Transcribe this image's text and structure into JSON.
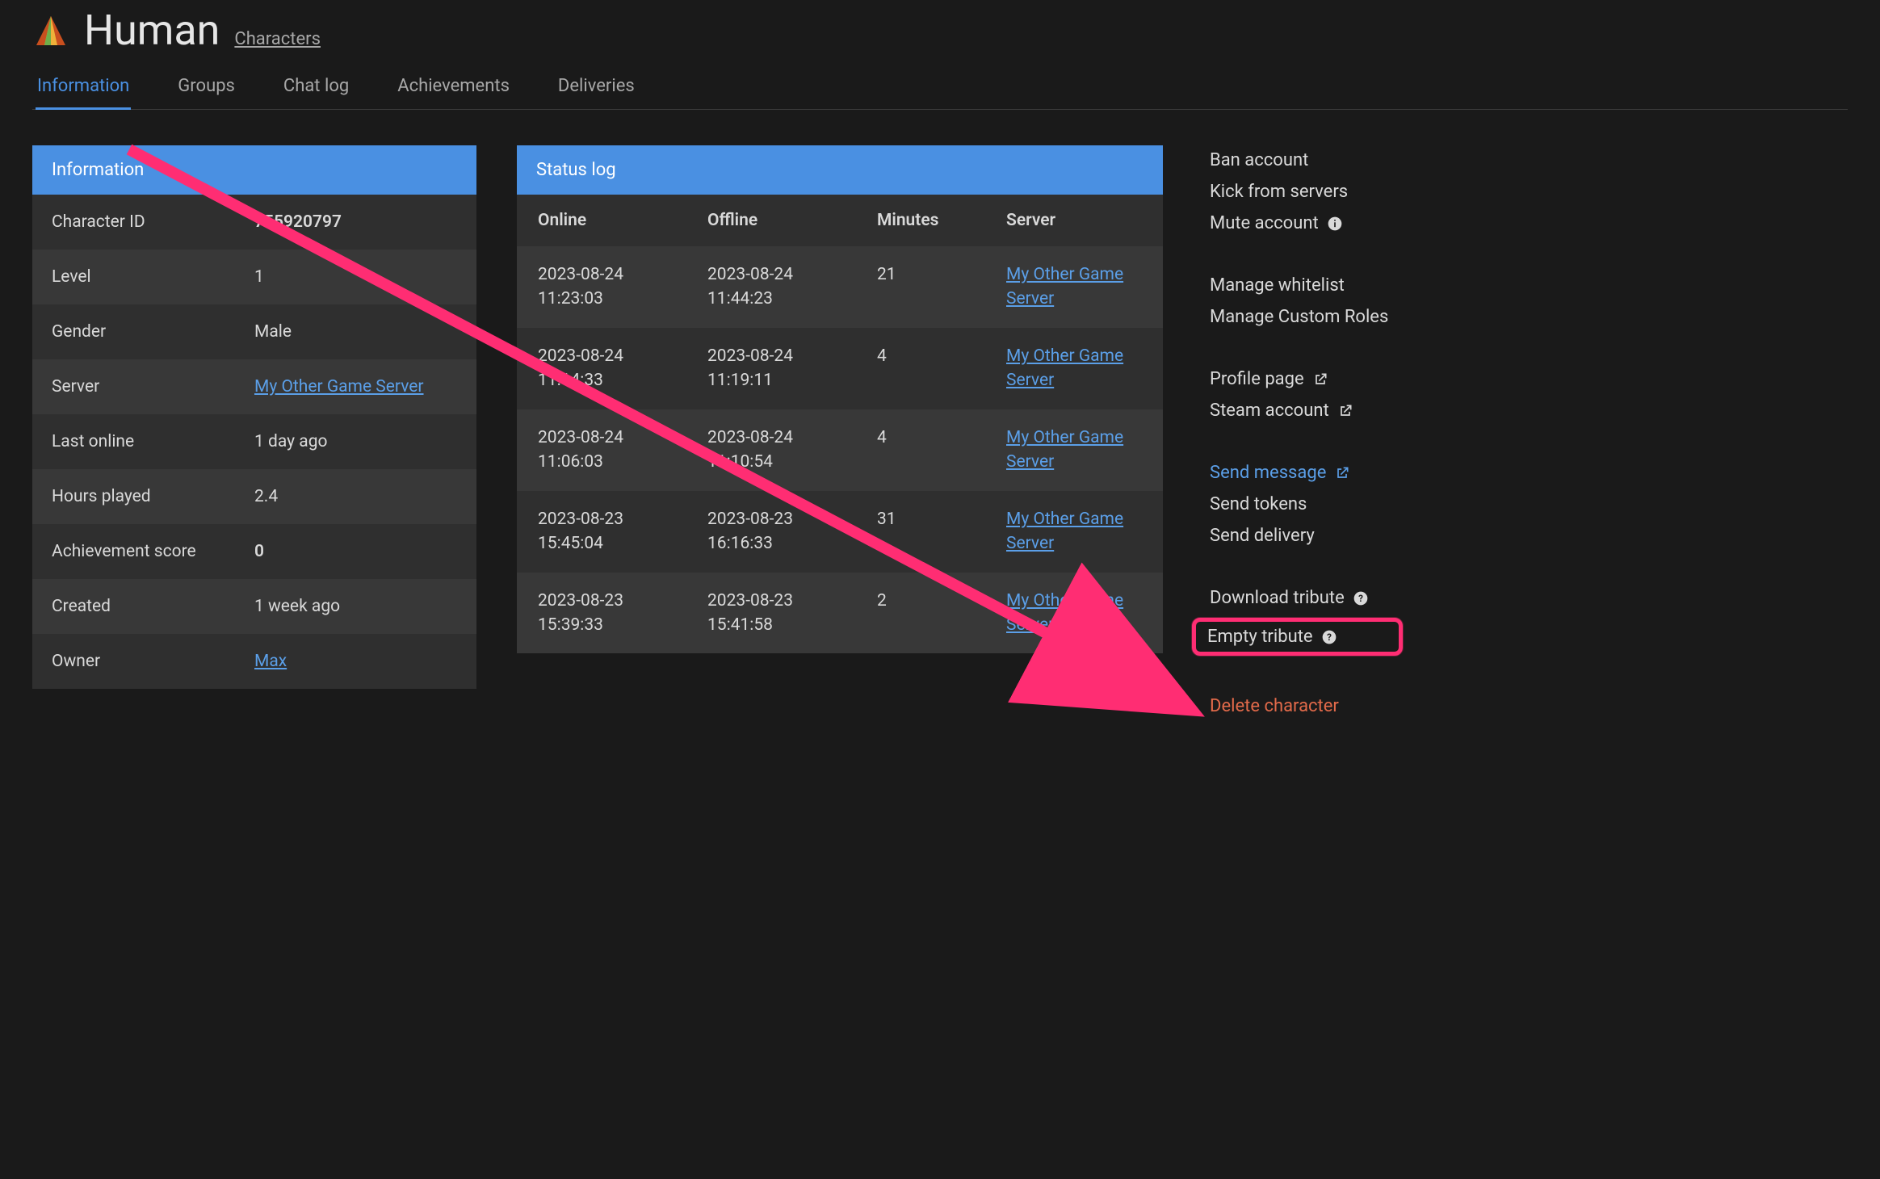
{
  "header": {
    "title": "Human",
    "breadcrumb": "Characters"
  },
  "tabs": [
    {
      "label": "Information",
      "active": true
    },
    {
      "label": "Groups",
      "active": false
    },
    {
      "label": "Chat log",
      "active": false
    },
    {
      "label": "Achievements",
      "active": false
    },
    {
      "label": "Deliveries",
      "active": false
    }
  ],
  "info_panel": {
    "title": "Information",
    "rows": [
      {
        "label": "Character ID",
        "value": "755920797",
        "bold": true
      },
      {
        "label": "Level",
        "value": "1"
      },
      {
        "label": "Gender",
        "value": "Male"
      },
      {
        "label": "Server",
        "value": "My Other Game Server",
        "is_link": true
      },
      {
        "label": "Last online",
        "value": "1 day ago"
      },
      {
        "label": "Hours played",
        "value": "2.4"
      },
      {
        "label": "Achievement score",
        "value": "0",
        "bold": true
      },
      {
        "label": "Created",
        "value": "1 week ago"
      },
      {
        "label": "Owner",
        "value": "Max",
        "is_link": true
      }
    ]
  },
  "status_panel": {
    "title": "Status log",
    "columns": {
      "online": "Online",
      "offline": "Offline",
      "minutes": "Minutes",
      "server": "Server"
    },
    "rows": [
      {
        "online": "2023-08-24 11:23:03",
        "offline": "2023-08-24 11:44:23",
        "minutes": "21",
        "server": "My Other Game Server"
      },
      {
        "online": "2023-08-24 11:14:33",
        "offline": "2023-08-24 11:19:11",
        "minutes": "4",
        "server": "My Other Game Server"
      },
      {
        "online": "2023-08-24 11:06:03",
        "offline": "2023-08-24 11:10:54",
        "minutes": "4",
        "server": "My Other Game Server"
      },
      {
        "online": "2023-08-23 15:45:04",
        "offline": "2023-08-23 16:16:33",
        "minutes": "31",
        "server": "My Other Game Server"
      },
      {
        "online": "2023-08-23 15:39:33",
        "offline": "2023-08-23 15:41:58",
        "minutes": "2",
        "server": "My Other Game Server"
      }
    ]
  },
  "actions": {
    "ban": "Ban account",
    "kick": "Kick from servers",
    "mute": "Mute account",
    "whitelist": "Manage whitelist",
    "roles": "Manage Custom Roles",
    "profile": "Profile page",
    "steam": "Steam account",
    "send_message": "Send message",
    "send_tokens": "Send tokens",
    "send_delivery": "Send delivery",
    "download_tribute": "Download tribute",
    "empty_tribute": "Empty tribute",
    "delete_character": "Delete character"
  }
}
